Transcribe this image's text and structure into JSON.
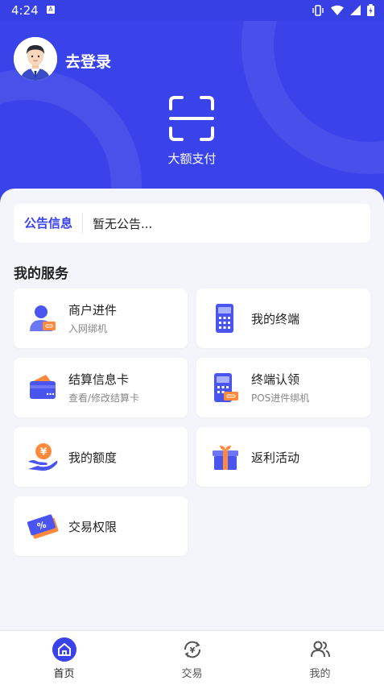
{
  "status_bar": {
    "time": "4:24",
    "notification_letter": "A"
  },
  "header": {
    "login_label": "去登录",
    "scan_label": "大额支付"
  },
  "notice": {
    "title": "公告信息",
    "text": "暂无公告..."
  },
  "services": {
    "section_title": "我的服务",
    "items": [
      {
        "title": "商户进件",
        "subtitle": "入网绑机",
        "icon": "merchant-icon"
      },
      {
        "title": "我的终端",
        "subtitle": "",
        "icon": "terminal-icon"
      },
      {
        "title": "结算信息卡",
        "subtitle": "查看/修改结算卡",
        "icon": "wallet-card-icon"
      },
      {
        "title": "终端认领",
        "subtitle": "POS进件绑机",
        "icon": "pos-claim-icon"
      },
      {
        "title": "我的额度",
        "subtitle": "",
        "icon": "yen-hand-icon"
      },
      {
        "title": "返利活动",
        "subtitle": "",
        "icon": "gift-icon"
      },
      {
        "title": "交易权限",
        "subtitle": "",
        "icon": "ticket-percent-icon"
      }
    ]
  },
  "bottom_nav": {
    "items": [
      {
        "label": "首页",
        "icon": "home-icon",
        "active": true
      },
      {
        "label": "交易",
        "icon": "yen-cycle-icon",
        "active": false
      },
      {
        "label": "我的",
        "icon": "people-icon",
        "active": false
      }
    ]
  },
  "colors": {
    "brand": "#3A43EA",
    "accent_orange": "#FF8A3D",
    "background": "#F4F5FA"
  }
}
